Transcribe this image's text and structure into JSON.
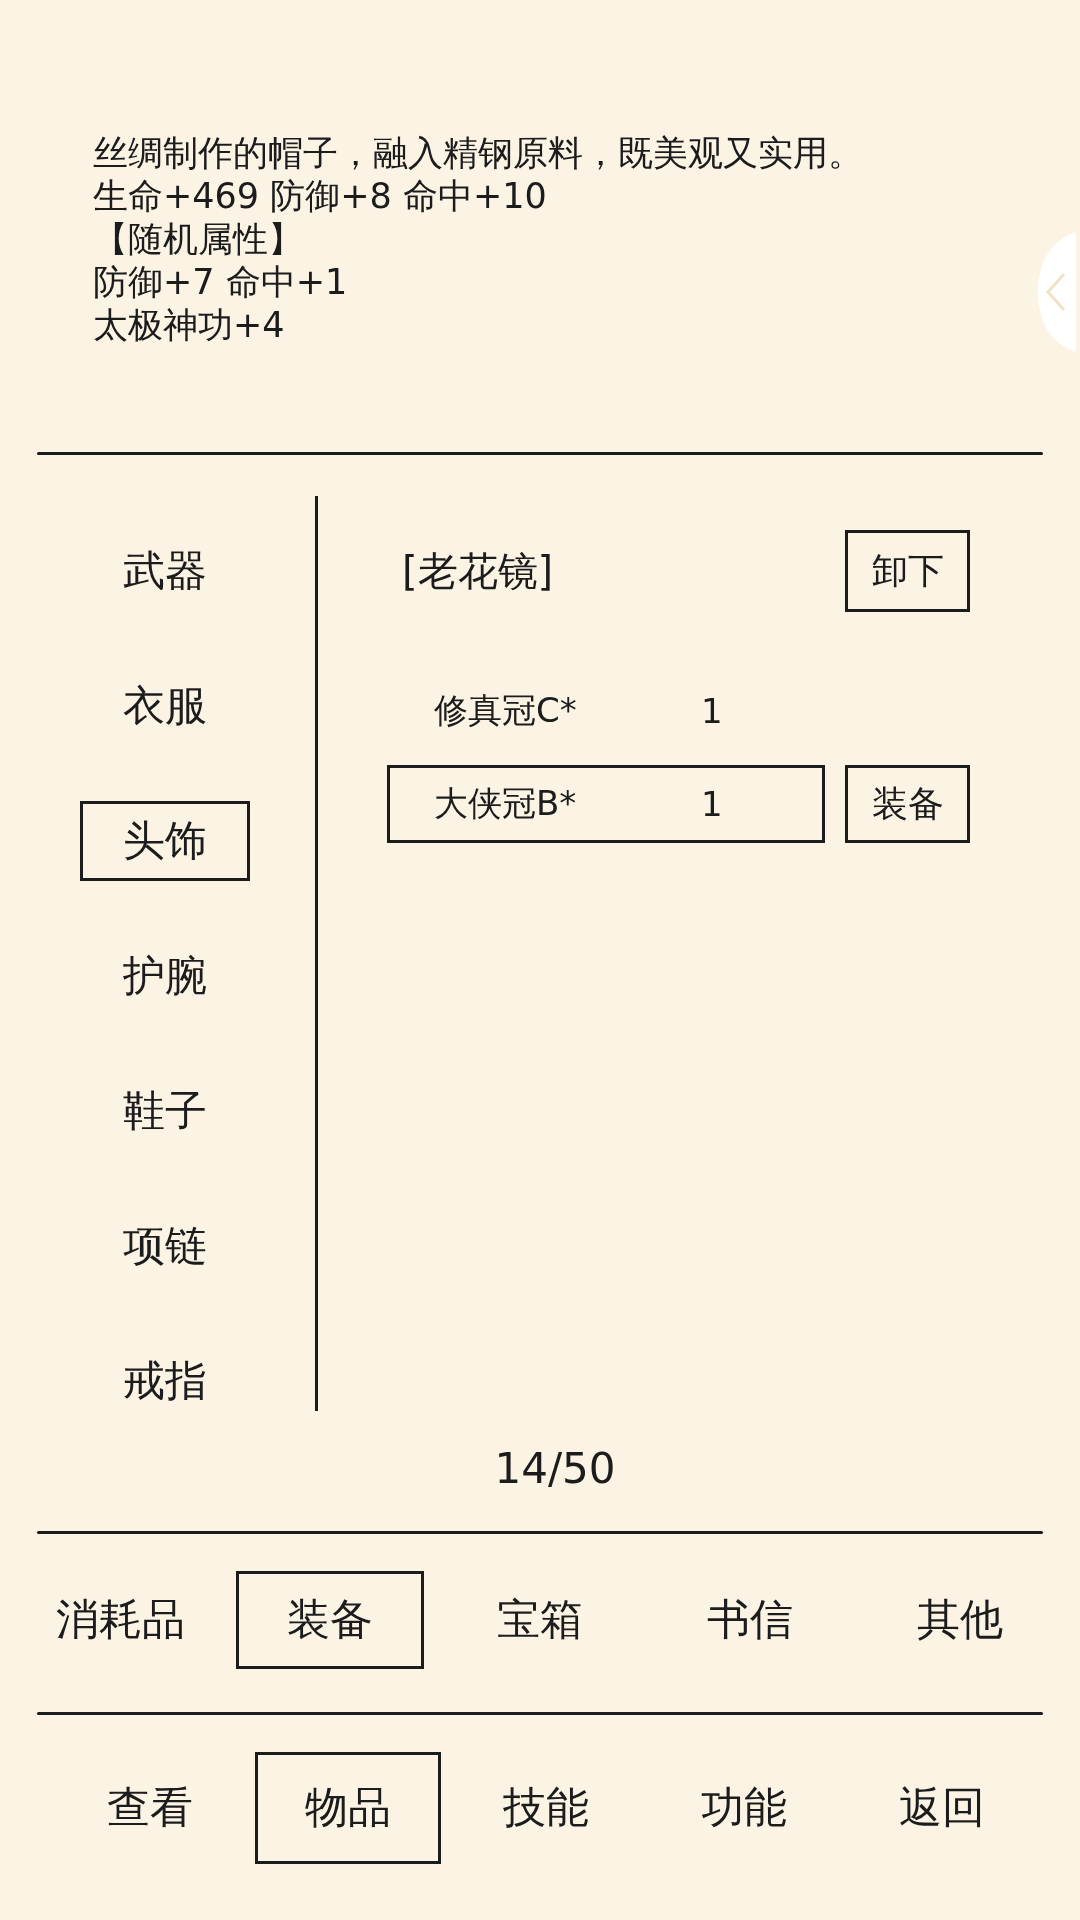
{
  "description": {
    "lines": [
      "丝绸制作的帽子，融入精钢原料，既美观又实用。",
      "生命+469 防御+8 命中+10",
      "【随机属性】",
      "防御+7 命中+1",
      "太极神功+4"
    ]
  },
  "slots": [
    {
      "label": "武器",
      "selected": false
    },
    {
      "label": "衣服",
      "selected": false
    },
    {
      "label": "头饰",
      "selected": true
    },
    {
      "label": "护腕",
      "selected": false
    },
    {
      "label": "鞋子",
      "selected": false
    },
    {
      "label": "项链",
      "selected": false
    },
    {
      "label": "戒指",
      "selected": false
    }
  ],
  "equipped": {
    "name": "[老花镜]",
    "action": "卸下"
  },
  "items": [
    {
      "name": "修真冠C*",
      "count": "1",
      "selected": false
    },
    {
      "name": "大侠冠B*",
      "count": "1",
      "selected": true,
      "action": "装备"
    }
  ],
  "capacity": "14/50",
  "categories": [
    {
      "label": "消耗品",
      "selected": false
    },
    {
      "label": "装备",
      "selected": true
    },
    {
      "label": "宝箱",
      "selected": false
    },
    {
      "label": "书信",
      "selected": false
    },
    {
      "label": "其他",
      "selected": false
    }
  ],
  "nav": [
    {
      "label": "查看",
      "selected": false
    },
    {
      "label": "物品",
      "selected": true
    },
    {
      "label": "技能",
      "selected": false
    },
    {
      "label": "功能",
      "selected": false
    },
    {
      "label": "返回",
      "selected": false
    }
  ]
}
